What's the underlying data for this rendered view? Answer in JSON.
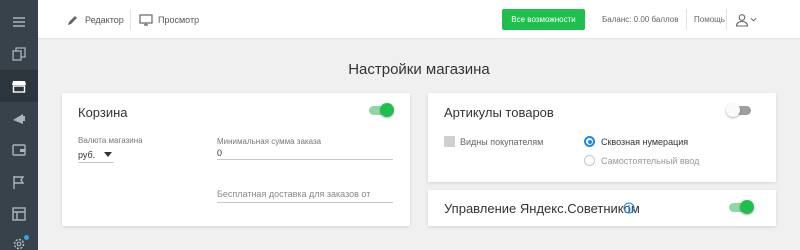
{
  "toolbar": {
    "editor_label": "Редактор",
    "preview_label": "Просмотр",
    "cta_label": "Все возможности",
    "balance_label": "Баланс: 0.00 баллов",
    "help_label": "Помощь"
  },
  "page": {
    "title": "Настройки магазина"
  },
  "cart_card": {
    "title": "Корзина",
    "enabled": true,
    "currency_label": "Валюта магазина",
    "currency_value": "руб.",
    "min_order_label": "Минимальная сумма заказа",
    "min_order_value": "0",
    "free_delivery_placeholder": "Бесплатная доставка для заказов от"
  },
  "sku_card": {
    "title": "Артикулы товаров",
    "enabled": false,
    "visible_checkbox_label": "Видны покупателям",
    "radio_options": [
      "Сквозная нумерация",
      "Самостоятельный ввод"
    ],
    "selected_option": "Сквозная нумерация"
  },
  "advisor_card": {
    "title": "Управление Яндекс.Советником",
    "enabled": true
  },
  "colors": {
    "sidebar": "#37424b",
    "accent_green": "#1fbf4e",
    "radio_blue": "#1e88e5"
  }
}
